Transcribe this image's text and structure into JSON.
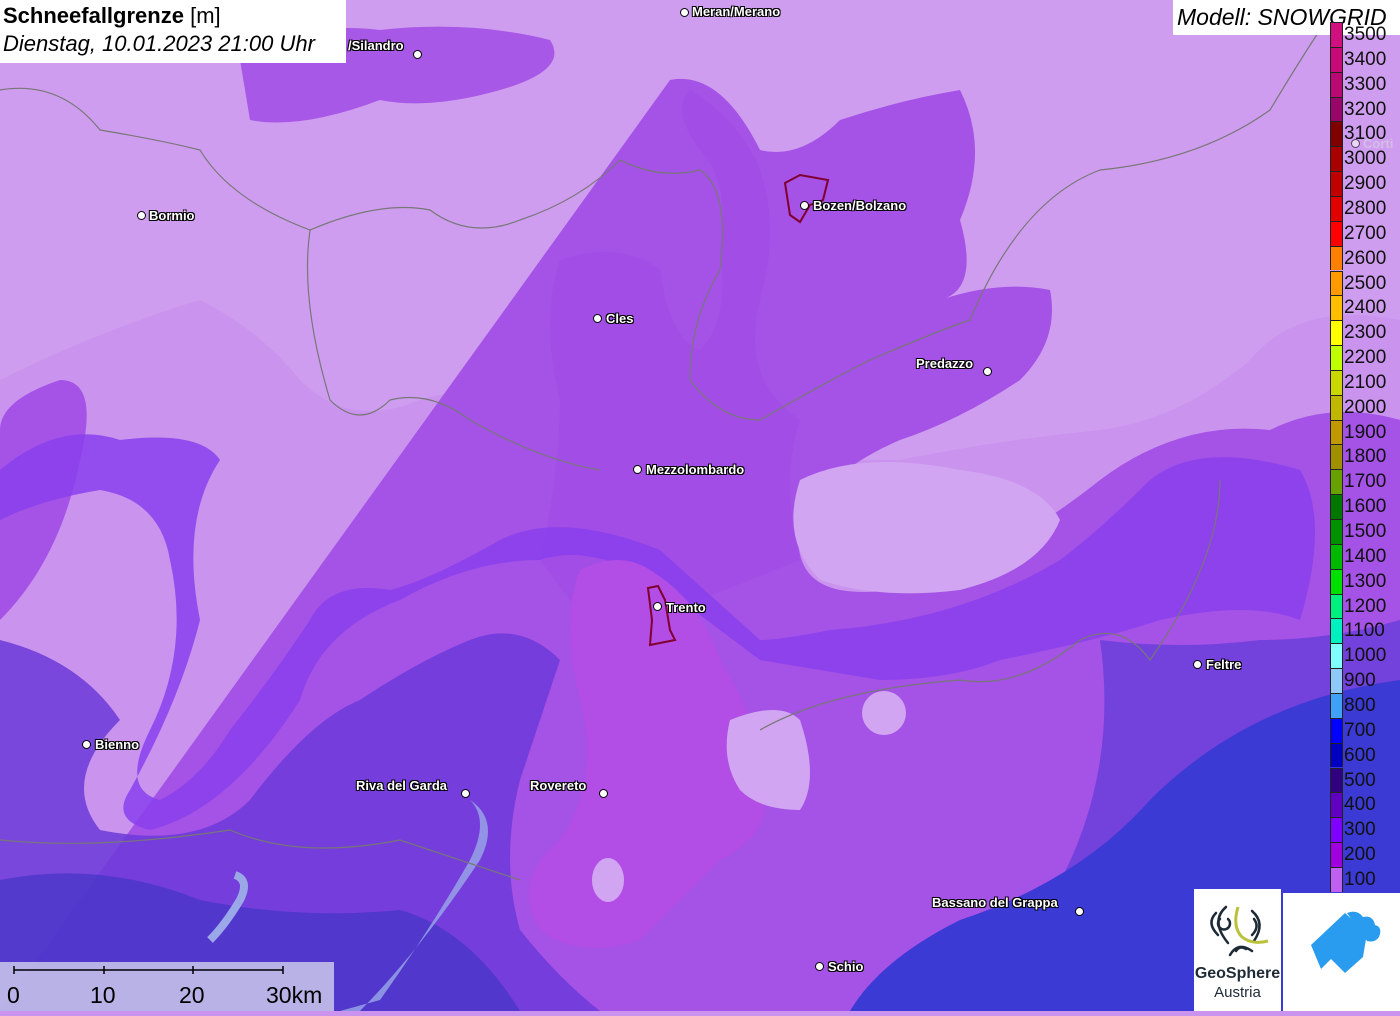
{
  "header": {
    "title": "Schneefallgrenze",
    "unit": "[m]",
    "datetime": "Dienstag, 10.01.2023 21:00 Uhr",
    "model": "Modell: SNOWGRID"
  },
  "cities": [
    {
      "name": "Meran/Merano"
    },
    {
      "name": "/Silandro"
    },
    {
      "name": "Bormio"
    },
    {
      "name": "Bozen/Bolzano"
    },
    {
      "name": "Cles"
    },
    {
      "name": "Predazzo"
    },
    {
      "name": "Mezzolombardo"
    },
    {
      "name": "Trento"
    },
    {
      "name": "Feltre"
    },
    {
      "name": "Bienno"
    },
    {
      "name": "Riva del Garda"
    },
    {
      "name": "Rovereto"
    },
    {
      "name": "Bassano del Grappa"
    },
    {
      "name": "Schio"
    },
    {
      "name": "Corti"
    }
  ],
  "legend": [
    {
      "label": "3500",
      "color": "#d0107e"
    },
    {
      "label": "3400",
      "color": "#c80a78"
    },
    {
      "label": "3300",
      "color": "#b80a72"
    },
    {
      "label": "3200",
      "color": "#98066a"
    },
    {
      "label": "3100",
      "color": "#800000"
    },
    {
      "label": "3000",
      "color": "#a80000"
    },
    {
      "label": "2900",
      "color": "#c00000"
    },
    {
      "label": "2800",
      "color": "#e00000"
    },
    {
      "label": "2700",
      "color": "#ff0000"
    },
    {
      "label": "2600",
      "color": "#ff8000"
    },
    {
      "label": "2500",
      "color": "#ff9a00"
    },
    {
      "label": "2400",
      "color": "#ffbf00"
    },
    {
      "label": "2300",
      "color": "#ffff00"
    },
    {
      "label": "2200",
      "color": "#c0ff00"
    },
    {
      "label": "2100",
      "color": "#c8d800"
    },
    {
      "label": "2000",
      "color": "#c0b800"
    },
    {
      "label": "1900",
      "color": "#c09800"
    },
    {
      "label": "1800",
      "color": "#a09000"
    },
    {
      "label": "1700",
      "color": "#68a000"
    },
    {
      "label": "1600",
      "color": "#007800"
    },
    {
      "label": "1500",
      "color": "#009000"
    },
    {
      "label": "1400",
      "color": "#00b800"
    },
    {
      "label": "1300",
      "color": "#00e000"
    },
    {
      "label": "1200",
      "color": "#00f080"
    },
    {
      "label": "1100",
      "color": "#00f0c0"
    },
    {
      "label": "1000",
      "color": "#80ffff"
    },
    {
      "label": "900",
      "color": "#90c8f8"
    },
    {
      "label": "800",
      "color": "#40a0f8"
    },
    {
      "label": "700",
      "color": "#0000ff"
    },
    {
      "label": "600",
      "color": "#0000c0"
    },
    {
      "label": "500",
      "color": "#300080"
    },
    {
      "label": "400",
      "color": "#6000c0"
    },
    {
      "label": "300",
      "color": "#8000ff"
    },
    {
      "label": "200",
      "color": "#a000e0"
    },
    {
      "label": "100",
      "color": "#c060f0"
    }
  ],
  "scale_bar": {
    "labels": [
      "0",
      "10",
      "20",
      "30km"
    ]
  },
  "logos": {
    "geosphere_line1": "GeoSphere",
    "geosphere_line2": "Austria"
  }
}
